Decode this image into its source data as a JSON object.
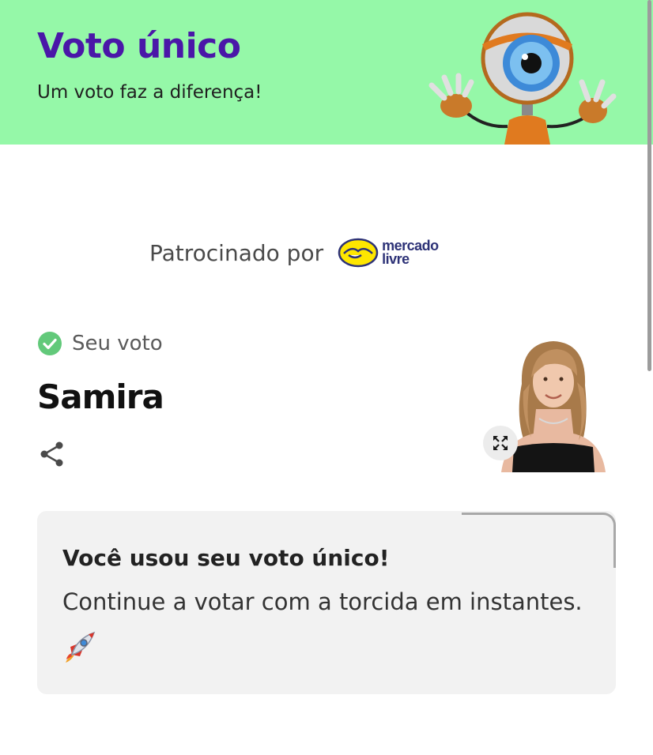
{
  "header": {
    "title": "Voto único",
    "subtitle": "Um voto faz a diferença!",
    "background_color": "#95f8a8",
    "title_color": "#4a17a8"
  },
  "sponsor": {
    "label": "Patrocinado por",
    "logo_line1": "mercado",
    "logo_line2": "livre"
  },
  "vote": {
    "status_label": "Seu voto",
    "status_icon": "check-circle-icon",
    "status_color": "#62c97a",
    "candidate_name": "Samira"
  },
  "card": {
    "title": "Você usou seu voto único!",
    "body": "Continue a votar com a torcida em instantes.",
    "emoji_icon": "rocket-icon"
  },
  "icons": {
    "share": "share-icon",
    "expand": "expand-icon"
  }
}
